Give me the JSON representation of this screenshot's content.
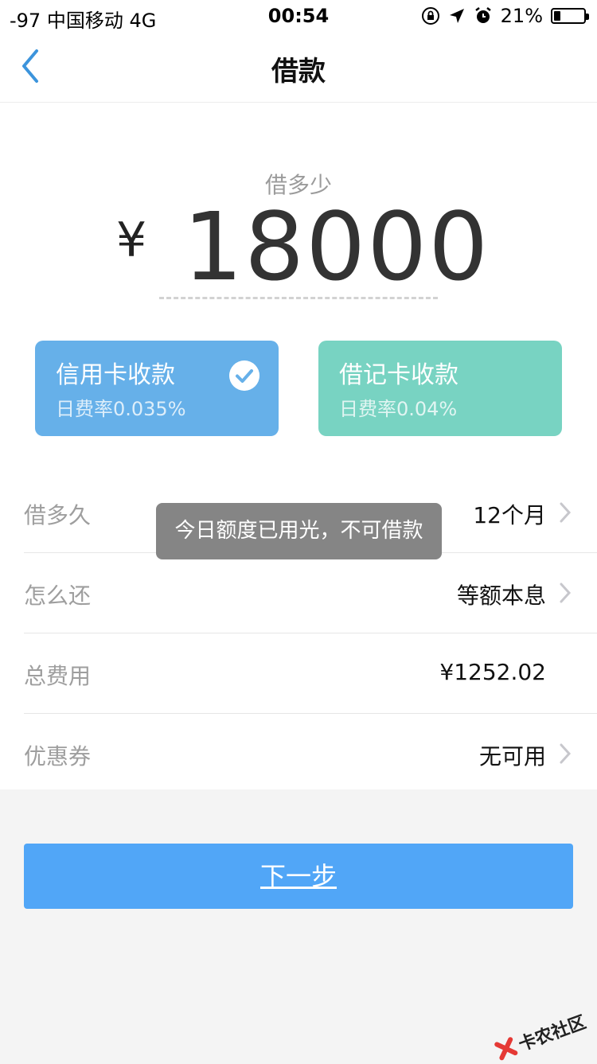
{
  "status_bar": {
    "carrier": "-97 中国移动   4G",
    "time": "00:54",
    "battery": "21%",
    "battery_level": 0.21
  },
  "nav": {
    "title": "借款",
    "back_icon": "chevron-left-icon"
  },
  "amount": {
    "label": "借多少",
    "currency": "¥",
    "value": "18000"
  },
  "cards": [
    {
      "name": "信用卡收款",
      "rate": "日费率0.035%",
      "selected": true
    },
    {
      "name": "借记卡收款",
      "rate": "日费率0.04%",
      "selected": false
    }
  ],
  "rows": [
    {
      "label": "借多久",
      "value": "12个月",
      "has_arrow": true
    },
    {
      "label": "怎么还",
      "value": "等额本息",
      "has_arrow": true
    },
    {
      "label": "总费用",
      "value": "¥1252.02",
      "has_arrow": false
    },
    {
      "label": "优惠券",
      "value": "无可用",
      "has_arrow": true
    }
  ],
  "toast": "今日额度已用光，不可借款",
  "next_button": "下一步",
  "watermark": "卡农社区",
  "colors": {
    "accent": "#51a6f7",
    "credit_card": "#66b0e9",
    "debit_card": "#78d3c2",
    "back_arrow": "#3c94dc"
  }
}
